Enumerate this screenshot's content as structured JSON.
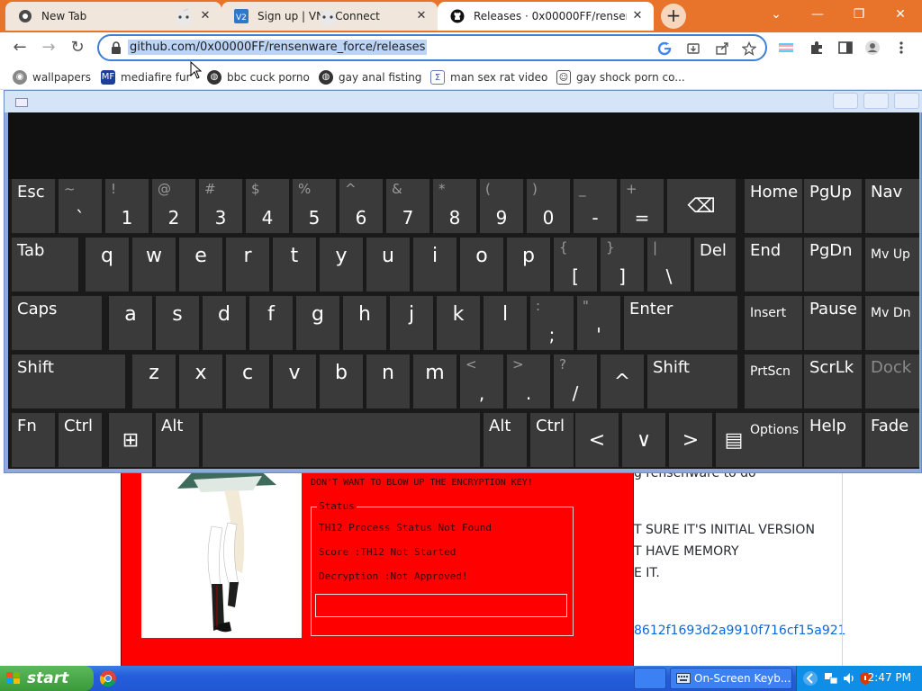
{
  "browser": {
    "tabs": [
      {
        "label": "New Tab",
        "icon": "chrome-icon",
        "active": false
      },
      {
        "label": "Sign up | VNC Connect",
        "icon": "vnc-icon",
        "active": false
      },
      {
        "label": "Releases · 0x00000FF/rensenw",
        "icon": "github-icon",
        "active": true
      }
    ],
    "new_tab_symbol": "+",
    "window_controls": {
      "chevron": "⌄",
      "minimize": "—",
      "restore": "❐",
      "close": "✕"
    },
    "url": "github.com/0x00000FF/rensenware_force/releases",
    "nav": {
      "back": "←",
      "forward": "→",
      "reload": "↻"
    },
    "toolbar_icons": [
      "google-icon",
      "install-icon",
      "share-icon",
      "star-icon",
      "extensions-icon",
      "side-panel-icon",
      "profile-icon",
      "menu-icon"
    ]
  },
  "bookmarks": [
    {
      "label": "wallpapers"
    },
    {
      "label": "mediafire fur"
    },
    {
      "label": "bbc cuck porno"
    },
    {
      "label": "gay anal fisting"
    },
    {
      "label": "man sex rat video"
    },
    {
      "label": "gay shock porn co..."
    }
  ],
  "page_background": {
    "text_lines": [
      "g rensenware to do",
      "T SURE IT'S INITIAL VERSION",
      "T HAVE MEMORY",
      "E IT.",
      "8612f1693d2a9910f716cf15a921"
    ]
  },
  "ransom_window": {
    "warning": "DON'T WANT TO BLOW UP THE ENCRYPTION KEY!",
    "group_title": "Status",
    "lines": [
      "TH12 Process Status Not Found",
      "Score :TH12 Not Started",
      "Decryption :Not Approved!"
    ]
  },
  "keyboard": {
    "row1": [
      {
        "label": "Esc"
      },
      {
        "shift": "~",
        "main": "`"
      },
      {
        "shift": "!",
        "main": "1"
      },
      {
        "shift": "@",
        "main": "2"
      },
      {
        "shift": "#",
        "main": "3"
      },
      {
        "shift": "$",
        "main": "4"
      },
      {
        "shift": "%",
        "main": "5"
      },
      {
        "shift": "^",
        "main": "6"
      },
      {
        "shift": "&",
        "main": "7"
      },
      {
        "shift": "*",
        "main": "8"
      },
      {
        "shift": "(",
        "main": "9"
      },
      {
        "shift": ")",
        "main": "0"
      },
      {
        "shift": "_",
        "main": "-"
      },
      {
        "shift": "+",
        "main": "="
      },
      {
        "label": "⌫"
      }
    ],
    "row2": [
      {
        "label": "Tab"
      },
      {
        "main": "q"
      },
      {
        "main": "w"
      },
      {
        "main": "e"
      },
      {
        "main": "r"
      },
      {
        "main": "t"
      },
      {
        "main": "y"
      },
      {
        "main": "u"
      },
      {
        "main": "i"
      },
      {
        "main": "o"
      },
      {
        "main": "p"
      },
      {
        "shift": "{",
        "main": "["
      },
      {
        "shift": "}",
        "main": "]"
      },
      {
        "shift": "|",
        "main": "\\"
      },
      {
        "label": "Del"
      }
    ],
    "row3": [
      {
        "label": "Caps"
      },
      {
        "main": "a"
      },
      {
        "main": "s"
      },
      {
        "main": "d"
      },
      {
        "main": "f"
      },
      {
        "main": "g"
      },
      {
        "main": "h"
      },
      {
        "main": "j"
      },
      {
        "main": "k"
      },
      {
        "main": "l"
      },
      {
        "shift": ":",
        "main": ";"
      },
      {
        "shift": "\"",
        "main": "'"
      },
      {
        "label": "Enter"
      }
    ],
    "row4": [
      {
        "label": "Shift"
      },
      {
        "main": "z"
      },
      {
        "main": "x"
      },
      {
        "main": "c"
      },
      {
        "main": "v"
      },
      {
        "main": "b"
      },
      {
        "main": "n"
      },
      {
        "main": "m"
      },
      {
        "shift": "<",
        "main": ","
      },
      {
        "shift": ">",
        "main": "."
      },
      {
        "shift": "?",
        "main": "/"
      },
      {
        "label": "^"
      },
      {
        "label": "Shift"
      }
    ],
    "row5": [
      {
        "label": "Fn"
      },
      {
        "label": "Ctrl"
      },
      {
        "label": "⊞"
      },
      {
        "label": "Alt"
      },
      {
        "label": ""
      },
      {
        "label": "Alt"
      },
      {
        "label": "Ctrl"
      },
      {
        "label": "<"
      },
      {
        "label": "∨"
      },
      {
        "label": ">"
      },
      {
        "label": "▤"
      }
    ],
    "nav_keys": [
      {
        "label": "Home"
      },
      {
        "label": "PgUp"
      },
      {
        "label": "Nav"
      },
      {
        "label": "End"
      },
      {
        "label": "PgDn"
      },
      {
        "label": "Mv Up"
      },
      {
        "label": "Insert"
      },
      {
        "label": "Pause"
      },
      {
        "label": "Mv Dn"
      },
      {
        "label": "PrtScn"
      },
      {
        "label": "ScrLk"
      },
      {
        "label": "Dock"
      },
      {
        "label": "Options"
      },
      {
        "label": "Help"
      },
      {
        "label": "Fade"
      }
    ]
  },
  "taskbar": {
    "start_label": "start",
    "on_screen_keyboard": "On-Screen Keyb...",
    "clock": "2:47 PM"
  }
}
